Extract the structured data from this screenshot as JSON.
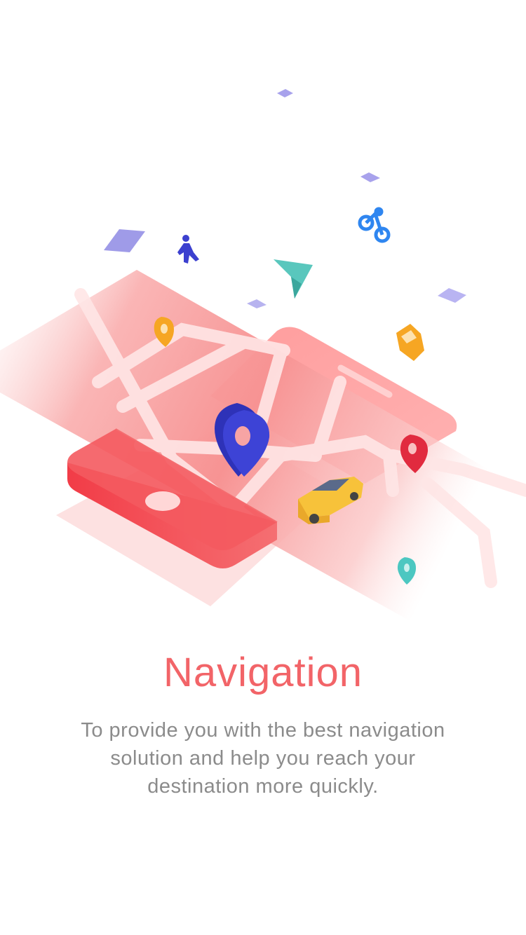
{
  "onboarding": {
    "title": "Navigation",
    "description": "To provide you with the best navigation solution and help you reach your destination more quickly."
  },
  "colors": {
    "title": "#f26468",
    "description": "#8b8b8b",
    "phone": "#f24d55",
    "map_pin_main": "#3a3fd0",
    "map_pin_red": "#e8344a",
    "map_pin_orange": "#f6a623",
    "map_pin_teal": "#4cc7c1",
    "taxi": "#f7c23a",
    "diamond": "#a8a2ec"
  },
  "icons": [
    "phone-illustration",
    "map-illustration",
    "location-pin-icon",
    "taxi-icon",
    "pedestrian-icon",
    "bicycle-icon",
    "navigation-arrow-icon",
    "car-icon"
  ]
}
